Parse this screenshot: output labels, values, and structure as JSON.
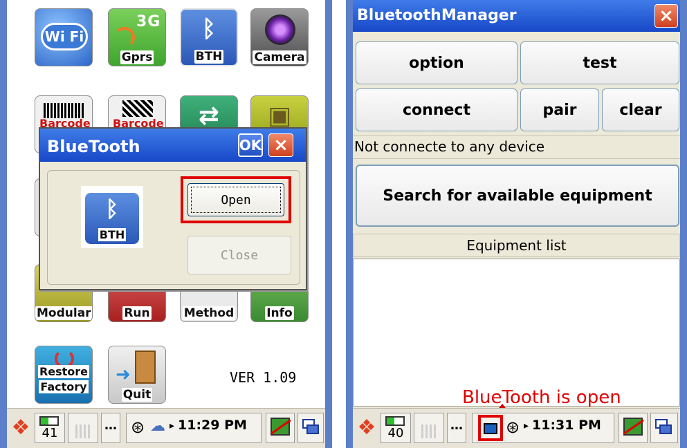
{
  "left": {
    "tiles": [
      {
        "label": "Wi Fi"
      },
      {
        "label": "Gprs",
        "badge": "3G"
      },
      {
        "label": "BTH"
      },
      {
        "label": "Camera"
      },
      {
        "label": "Barcode"
      },
      {
        "label": "Barcode"
      },
      {
        "label": "Modular"
      },
      {
        "label": "Run"
      },
      {
        "label": "Method"
      },
      {
        "label": "Info"
      },
      {
        "label": "Restore Factory",
        "line1": "Restore",
        "line2": "Factory"
      },
      {
        "label": "Quit"
      }
    ],
    "version": "VER 1.09",
    "dialog": {
      "title": "BlueTooth",
      "ok_label": "OK",
      "close_label": "×",
      "icon_label": "BTH",
      "open_label": "Open",
      "close_button_label": "Close"
    },
    "taskbar": {
      "battery": "41",
      "time": "11:29 PM"
    }
  },
  "right": {
    "title": "BluetoothManager",
    "close_label": "×",
    "buttons": {
      "option": "option",
      "test": "test",
      "connect": "connect",
      "pair": "pair",
      "clear": "clear",
      "search": "Search for  available equipment"
    },
    "status": "Not connecte to any device",
    "list_header": "Equipment list",
    "annotation": "BlueTooth is open",
    "taskbar": {
      "battery": "40",
      "time": "11:31 PM"
    }
  },
  "colors": {
    "accent_red": "#e00000",
    "title_blue": "#2a5fd9",
    "xp_border": "#7f9db9"
  }
}
